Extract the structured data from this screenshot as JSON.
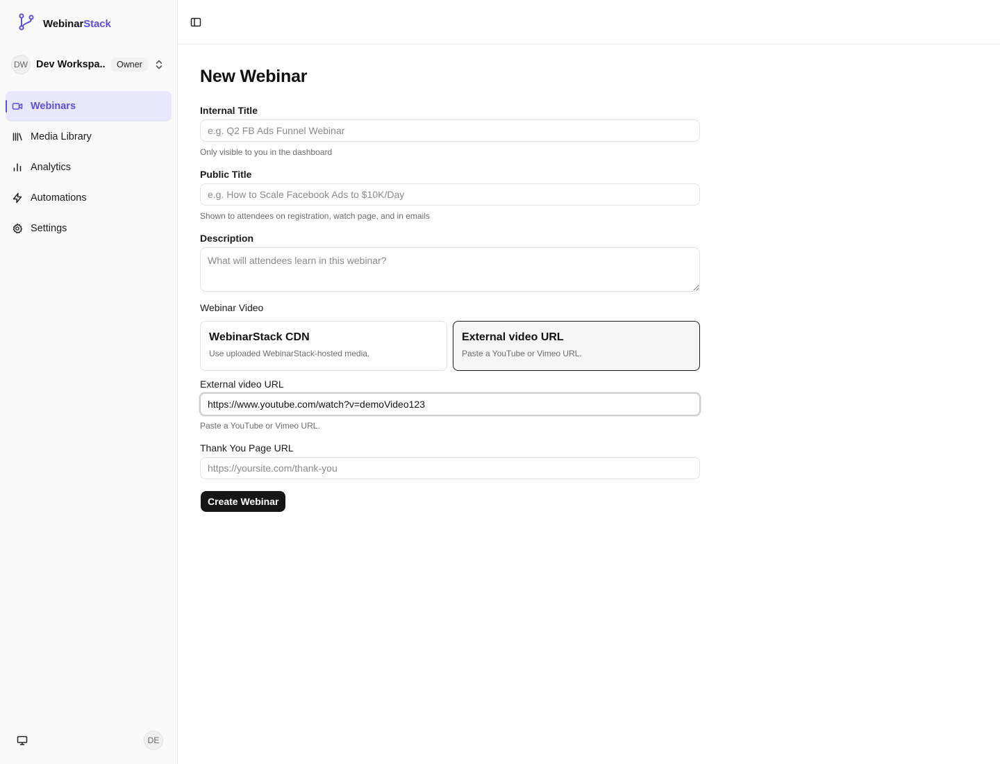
{
  "brand": {
    "name_main": "Webinar",
    "name_accent": "Stack",
    "accent_color": "#5b4fd6",
    "icon": "git-branch-logo-icon"
  },
  "workspace": {
    "initials": "DW",
    "name": "Dev Workspa...",
    "role": "Owner",
    "switch_icon": "chevrons-up-down-icon"
  },
  "sidebar": {
    "items": [
      {
        "label": "Webinars",
        "icon": "video-icon",
        "active": true
      },
      {
        "label": "Media Library",
        "icon": "library-icon",
        "active": false
      },
      {
        "label": "Analytics",
        "icon": "bar-chart-icon",
        "active": false
      },
      {
        "label": "Automations",
        "icon": "zap-icon",
        "active": false
      },
      {
        "label": "Settings",
        "icon": "gear-icon",
        "active": false
      }
    ],
    "footer": {
      "monitor_icon": "monitor-icon",
      "user_initials": "DE"
    }
  },
  "topbar": {
    "toggle_icon": "panel-left-icon"
  },
  "form": {
    "title": "New Webinar",
    "internal_title": {
      "label": "Internal Title",
      "placeholder": "e.g. Q2 FB Ads Funnel Webinar",
      "help": "Only visible to you in the dashboard"
    },
    "public_title": {
      "label": "Public Title",
      "placeholder": "e.g. How to Scale Facebook Ads to $10K/Day",
      "help": "Shown to attendees on registration, watch page, and in emails"
    },
    "description": {
      "label": "Description",
      "placeholder": "What will attendees learn in this webinar?"
    },
    "video": {
      "label": "Webinar Video",
      "options": [
        {
          "title": "WebinarStack CDN",
          "desc": "Use uploaded WebinarStack-hosted media.",
          "selected": false
        },
        {
          "title": "External video URL",
          "desc": "Paste a YouTube or Vimeo URL.",
          "selected": true
        }
      ]
    },
    "external_url": {
      "label": "External video URL",
      "value": "https://www.youtube.com/watch?v=demoVideo123",
      "help": "Paste a YouTube or Vimeo URL."
    },
    "thank_you": {
      "label": "Thank You Page URL",
      "placeholder": "https://yoursite.com/thank-you"
    },
    "submit_label": "Create Webinar"
  }
}
